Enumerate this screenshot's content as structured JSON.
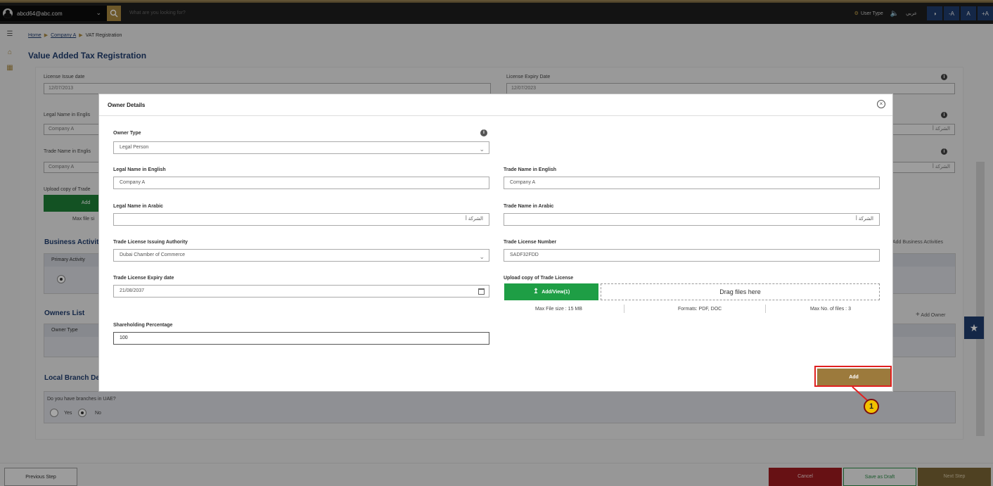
{
  "topbar": {
    "user_email": "abcd64@abc.com",
    "search_placeholder": "What are you looking for?",
    "user_type": "User Type",
    "language": "عربي",
    "font_decrease": "-A",
    "font_normal": "A",
    "font_increase": "+A"
  },
  "breadcrumb": {
    "home": "Home",
    "company": "Company A",
    "current": "VAT Registration"
  },
  "page": {
    "title": "Value Added Tax Registration"
  },
  "background_form": {
    "license_issue_date_label": "License Issue date",
    "license_issue_date_value": "12/07/2013",
    "license_expiry_date_label": "License Expiry Date",
    "license_expiry_date_value": "12/07/2023",
    "legal_name_en_label": "Legal Name in Englis",
    "legal_name_en_value": "Company A",
    "legal_name_ar_value": "الشركة أ",
    "trade_name_en_label": "Trade Name in Englis",
    "trade_name_en_value": "Company A",
    "trade_name_ar_value": "الشركة أ",
    "upload_label": "Upload copy of Trade",
    "upload_button": "Add",
    "max_file": "Max file si",
    "business_activities_title": "Business Activit",
    "add_business_activities": "Add Business Activities",
    "primary_activity_header": "Primary Activity",
    "owners_list_title": "Owners List",
    "add_owner": "Add Owner",
    "owner_type_header": "Owner Type",
    "local_branch_title": "Local Branch De",
    "branches_question": "Do you have branches in UAE?",
    "yes": "Yes",
    "no": "No"
  },
  "modal": {
    "title": "Owner Details",
    "owner_type_label": "Owner Type",
    "owner_type_value": "Legal Person",
    "legal_name_en_label": "Legal Name in English",
    "legal_name_en_value": "Company A",
    "trade_name_en_label": "Trade Name in English",
    "trade_name_en_value": "Company A",
    "legal_name_ar_label": "Legal Name in Arabic",
    "legal_name_ar_value": "الشركة أ",
    "trade_name_ar_label": "Trade Name in Arabic",
    "trade_name_ar_value": "الشركة أ",
    "issuing_authority_label": "Trade License Issuing Authority",
    "issuing_authority_value": "Dubai Chamber of Commerce",
    "license_number_label": "Trade License Number",
    "license_number_value": "SADF32FDD",
    "license_expiry_label": "Trade License Expiry date",
    "license_expiry_value": "21/08/2037",
    "upload_label": "Upload copy of Trade License",
    "upload_button": "Add/View(1)",
    "drag_text": "Drag files here",
    "max_size": "Max File size : 15 MB",
    "formats": "Formats: PDF, DOC",
    "max_files": "Max No. of files : 3",
    "shareholding_label": "Shareholding Percentage",
    "shareholding_value": "100",
    "add_button": "Add"
  },
  "annotation": {
    "step": "1",
    "color": "#e02020"
  },
  "footer": {
    "previous": "Previous Step",
    "cancel": "Cancel",
    "save_draft": "Save as Draft",
    "next": "Next Step"
  }
}
